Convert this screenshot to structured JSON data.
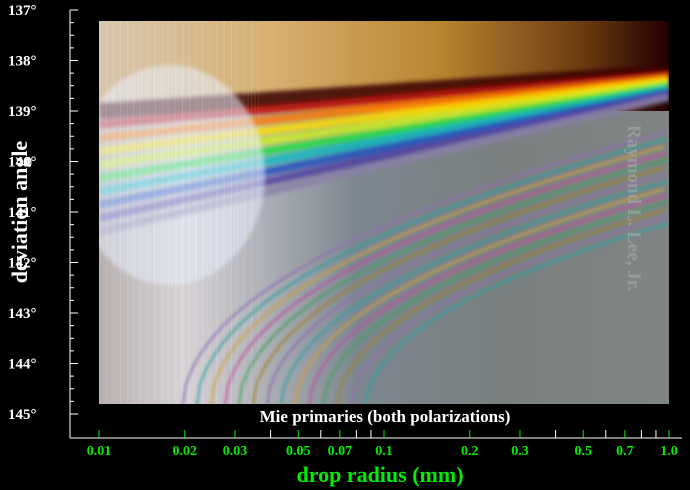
{
  "chart_data": {
    "type": "heatmap",
    "title": "Mie primaries (both polarizations)",
    "xlabel": "drop radius (mm)",
    "ylabel": "deviation angle",
    "x_scale": "log",
    "xlim": [
      0.01,
      1.0
    ],
    "x_ticks": [
      {
        "value": 0.01,
        "label": "0.01"
      },
      {
        "value": 0.02,
        "label": "0.02"
      },
      {
        "value": 0.03,
        "label": "0.03"
      },
      {
        "value": 0.05,
        "label": "0.05"
      },
      {
        "value": 0.07,
        "label": "0.07"
      },
      {
        "value": 0.1,
        "label": "0.1"
      },
      {
        "value": 0.2,
        "label": "0.2"
      },
      {
        "value": 0.3,
        "label": "0.3"
      },
      {
        "value": 0.5,
        "label": "0.5"
      },
      {
        "value": 0.7,
        "label": "0.7"
      },
      {
        "value": 1.0,
        "label": "1.0"
      }
    ],
    "x_minor_ticks": [
      0.04,
      0.06,
      0.08,
      0.09,
      0.4,
      0.6,
      0.8,
      0.9
    ],
    "ylim": [
      137,
      145
    ],
    "y_inverted": true,
    "y_ticks": [
      {
        "value": 137,
        "label": "137°"
      },
      {
        "value": 138,
        "label": "138°"
      },
      {
        "value": 139,
        "label": "139°"
      },
      {
        "value": 140,
        "label": "140°"
      },
      {
        "value": 141,
        "label": "141°"
      },
      {
        "value": 142,
        "label": "142°"
      },
      {
        "value": 143,
        "label": "143°"
      },
      {
        "value": 144,
        "label": "144°"
      },
      {
        "value": 145,
        "label": "145°"
      }
    ],
    "watermark": "Raymond L. Lee, Jr."
  },
  "colors": {
    "axis_text": "#ffffff",
    "x_axis_text": "#00ee00",
    "background": "#000000"
  }
}
